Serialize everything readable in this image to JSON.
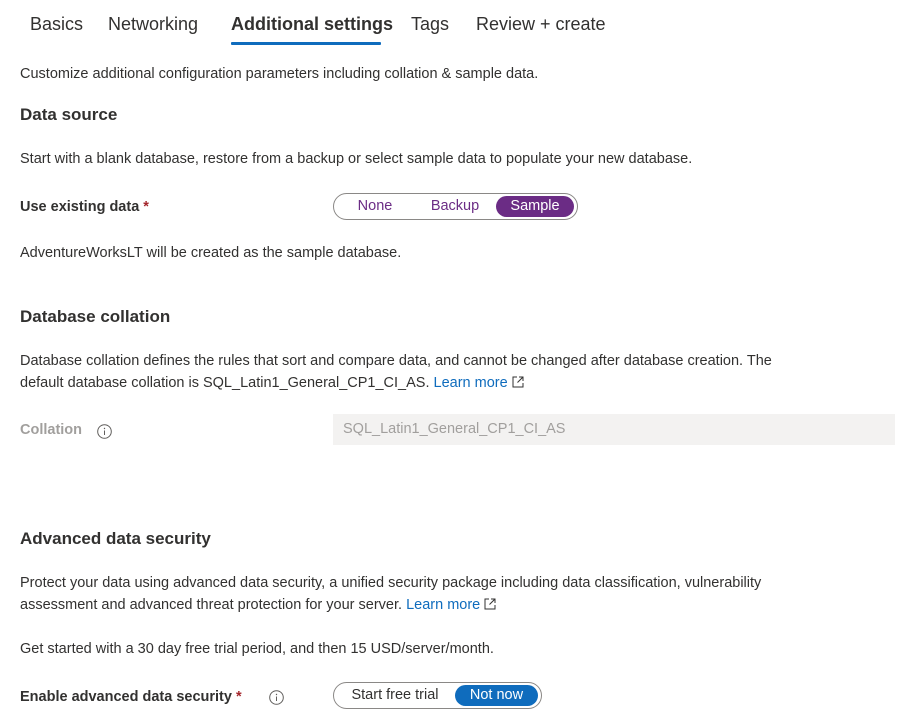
{
  "tabs": [
    "Basics",
    "Networking",
    "Additional settings",
    "Tags",
    "Review + create"
  ],
  "active_tab": "Additional settings",
  "intro": "Customize additional configuration parameters including collation & sample data.",
  "data_source": {
    "heading": "Data source",
    "description": "Start with a blank database, restore from a backup or select sample data to populate your new database.",
    "field_label": "Use existing data",
    "required_mark": "*",
    "options": [
      "None",
      "Backup",
      "Sample"
    ],
    "selected": "Sample",
    "note": "AdventureWorksLT will be created as the sample database."
  },
  "collation": {
    "heading": "Database collation",
    "description_line1": "Database collation defines the rules that sort and compare data, and cannot be changed after database creation. The",
    "description_line2": "default database collation is SQL_Latin1_General_CP1_CI_AS.",
    "learn_more": "Learn more",
    "field_label": "Collation",
    "value": "SQL_Latin1_General_CP1_CI_AS"
  },
  "security": {
    "heading": "Advanced data security",
    "description_line1": "Protect your data using advanced data security, a unified security package including data classification, vulnerability",
    "description_line2": "assessment and advanced threat protection for your server.",
    "learn_more": "Learn more",
    "pricing": "Get started with a 30 day free trial period, and then 15 USD/server/month.",
    "field_label": "Enable advanced data security",
    "required_mark": "*",
    "options": [
      "Start free trial",
      "Not now"
    ],
    "selected": "Not now"
  },
  "colors": {
    "tab_underline": "#0f6cbd",
    "link": "#0f6cbd",
    "selected_purple": "#6b2c85",
    "selected_blue": "#0f6cbd",
    "required": "#a4262c"
  }
}
